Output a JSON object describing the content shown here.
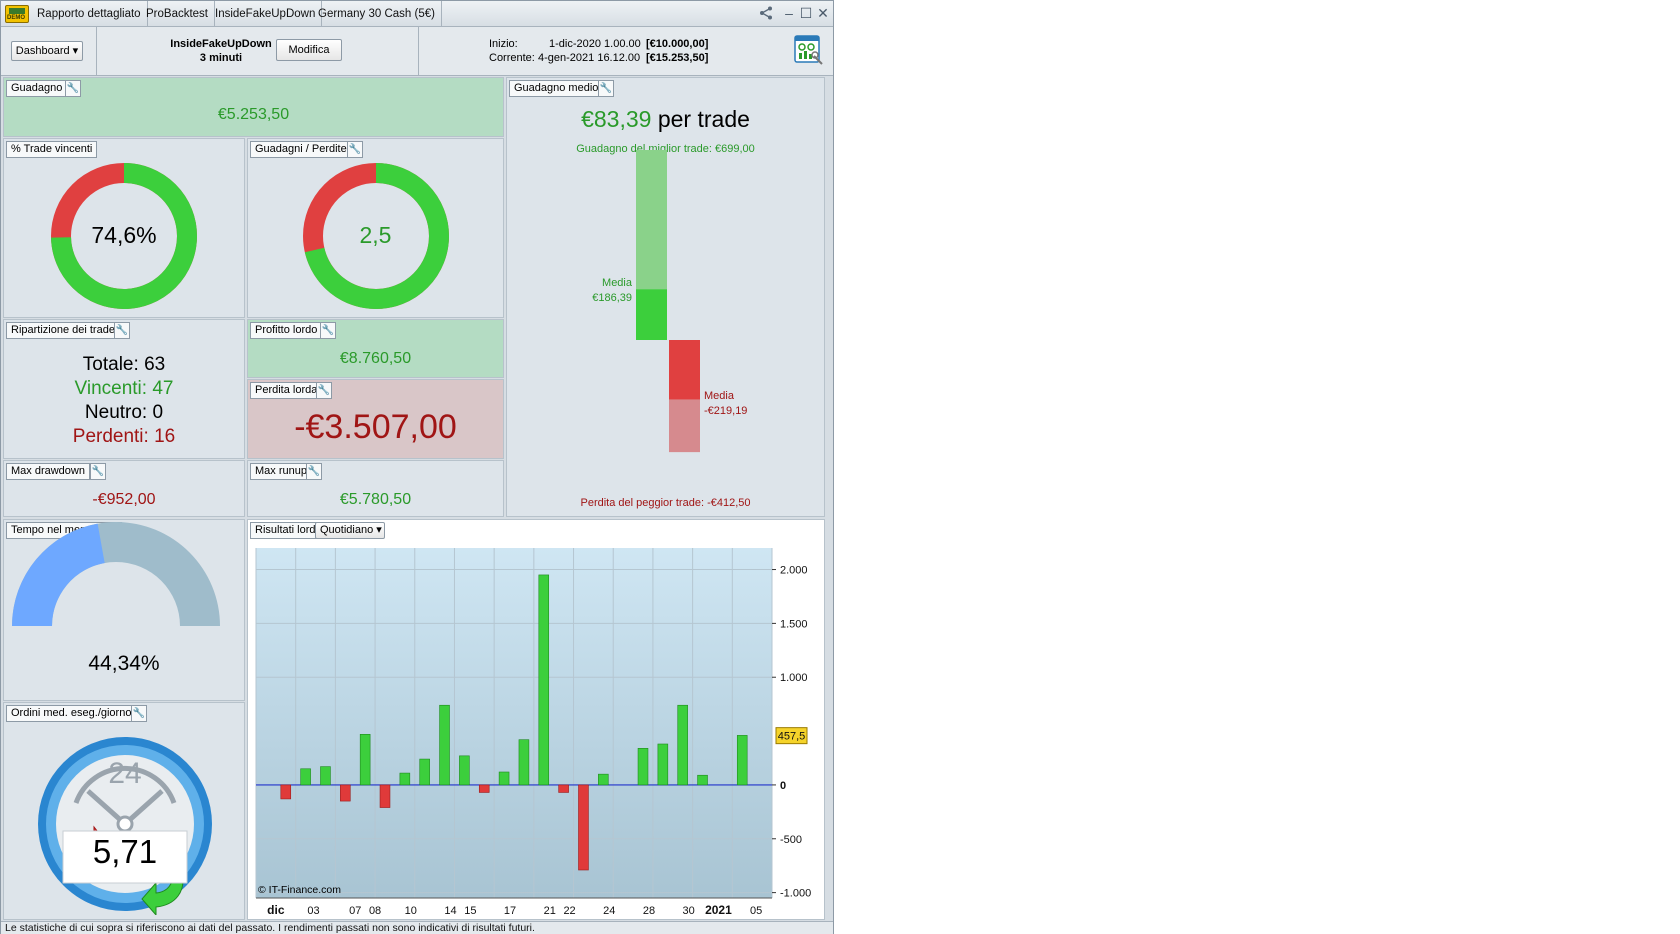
{
  "tabs": [
    {
      "label": "Rapporto dettagliato"
    },
    {
      "label": "ProBacktest"
    },
    {
      "label": "InsideFakeUpDown"
    },
    {
      "label": "Germany 30 Cash (5€)"
    }
  ],
  "logo_text": "DEMO",
  "header": {
    "dashboard_label": "Dashboard",
    "strategy_name": "InsideFakeUpDown",
    "timeframe": "3 minuti",
    "modify_label": "Modifica",
    "start_label": "Inizio:",
    "start_date": "1-dic-2020 1.00.00",
    "start_capital": "[€10.000,00]",
    "current_label": "Corrente:",
    "current_date": "4-gen-2021 16.12.00",
    "current_capital": "[€15.253,50]"
  },
  "guadagno": {
    "label": "Guadagno",
    "value": "€5.253,50"
  },
  "win_pct": {
    "label": "% Trade vincenti",
    "value": "74,6%",
    "fraction": 0.746
  },
  "gain_loss": {
    "label": "Guadagni / Perdite",
    "value": "2,5",
    "fraction": 0.714
  },
  "breakdown": {
    "label": "Ripartizione dei trade",
    "total_label": "Totale:",
    "total": "63",
    "win_label": "Vincenti:",
    "win": "47",
    "neutral_label": "Neutro:",
    "neutral": "0",
    "loss_label": "Perdenti:",
    "loss": "16"
  },
  "gross_profit": {
    "label": "Profitto lordo",
    "value": "€8.760,50"
  },
  "gross_loss": {
    "label": "Perdita lorda",
    "value": "-€3.507,00"
  },
  "max_drawdown": {
    "label": "Max drawdown",
    "value": "-€952,00"
  },
  "max_runup": {
    "label": "Max runup",
    "value": "€5.780,50"
  },
  "avg_gain": {
    "label": "Guadagno medio",
    "value": "€83,39",
    "suffix": "per trade",
    "best_label": "Guadagno del miglior trade: €699,00",
    "avg_win_label": "Media",
    "avg_win_value": "€186,39",
    "avg_loss_label": "Media",
    "avg_loss_value": "-€219,19",
    "worst_label": "Perdita del peggior trade: -€412,50",
    "best": 699.0,
    "avg_win": 186.39,
    "avg_loss": 219.19,
    "worst": 412.5
  },
  "time_in_market": {
    "label": "Tempo nel mercato",
    "value": "44,34%",
    "fraction": 0.4434
  },
  "orders_per_day": {
    "label": "Ordini med. eseg./giorno",
    "value": "5,71",
    "dial_label": "24"
  },
  "gross_results": {
    "label": "Risultati lordi",
    "period": "Quotidiano",
    "watermark": "© IT-Finance.com"
  },
  "chart_data": {
    "type": "bar",
    "title": "Risultati lordi",
    "x": [
      "dic 01",
      "dic 02",
      "dic 03",
      "dic 04",
      "dic 07",
      "dic 08",
      "dic 09",
      "dic 10",
      "dic 11",
      "dic 14",
      "dic 15",
      "dic 16",
      "dic 17",
      "dic 18",
      "dic 21",
      "dic 22",
      "dic 23",
      "dic 24",
      "dic 28",
      "dic 29",
      "dic 30",
      "gen 04"
    ],
    "values": [
      -130,
      150,
      170,
      -150,
      470,
      -210,
      110,
      240,
      740,
      270,
      -70,
      120,
      420,
      1950,
      -70,
      -790,
      100,
      340,
      380,
      740,
      90,
      460
    ],
    "slot_index": [
      1,
      2,
      3,
      4,
      5,
      6,
      7,
      8,
      9,
      10,
      11,
      12,
      13,
      14,
      15,
      16,
      17,
      19,
      20,
      21,
      22,
      24
    ],
    "slots": 26,
    "x_ticks": [
      "dic",
      "03",
      "07",
      "08",
      "10",
      "14",
      "15",
      "17",
      "21",
      "22",
      "24",
      "28",
      "30",
      "2021",
      "05"
    ],
    "x_tick_slot": [
      1,
      2.9,
      5,
      6,
      7.8,
      9.8,
      10.8,
      12.8,
      14.8,
      15.8,
      17.8,
      19.8,
      21.8,
      23.3,
      25.2
    ],
    "y_ticks": [
      "2.000",
      "1.500",
      "1.000",
      "0",
      "-500",
      "-1.000"
    ],
    "y_tick_values": [
      2000,
      1500,
      1000,
      0,
      -500,
      -1000
    ],
    "ylim": [
      -1050,
      2200
    ],
    "marker_value": 457.5,
    "marker_label": "457,5",
    "colors": {
      "positive": "#3ccf3c",
      "negative": "#e03a3a",
      "zero_line": "#2233cc"
    },
    "grid": true
  },
  "footer": "Le statistiche di cui sopra si riferiscono ai dati del passato. I rendimenti passati non sono indicativi di risultati futuri.",
  "colors": {
    "green": "#3ccf3c",
    "red": "#e04040",
    "value_green": "#2a9a2a",
    "value_red": "#a01515",
    "gauge_blue": "#6ea8ff",
    "gauge_gray": "#9fbccb"
  }
}
